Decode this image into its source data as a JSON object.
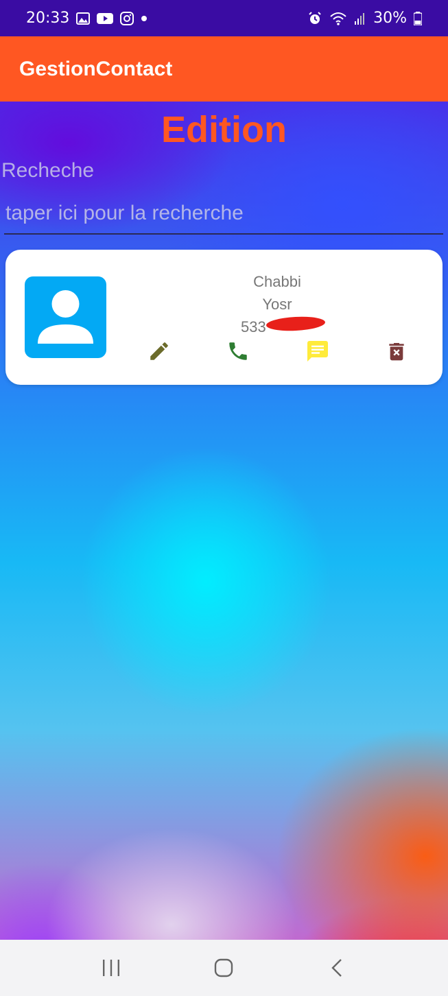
{
  "status_bar": {
    "time": "20:33",
    "battery": "30%",
    "left_icons": [
      "gallery-icon",
      "youtube-icon",
      "instagram-icon",
      "dot-icon"
    ],
    "right_icons": [
      "alarm-icon",
      "wifi-icon",
      "signal-icon",
      "battery-icon"
    ]
  },
  "app_bar": {
    "title": "GestionContact",
    "color": "#ff5722"
  },
  "main": {
    "heading": "Edition",
    "search": {
      "label": "Recheche",
      "placeholder": "taper ici pour la recherche",
      "value": ""
    }
  },
  "contacts": [
    {
      "last_name": "Chabbi",
      "first_name": "Yosr",
      "phone_visible": "533",
      "avatar_icon": "person-icon",
      "actions": [
        {
          "name": "edit",
          "icon": "pencil-icon",
          "color": "#6b6b2a"
        },
        {
          "name": "call",
          "icon": "phone-icon",
          "color": "#2e7d32"
        },
        {
          "name": "message",
          "icon": "message-icon",
          "color": "#ffeb3b"
        },
        {
          "name": "delete",
          "icon": "trash-icon",
          "color": "#7b3b3b"
        }
      ]
    }
  ],
  "nav_bar": {
    "buttons": [
      "recents-icon",
      "home-icon",
      "back-icon"
    ]
  }
}
